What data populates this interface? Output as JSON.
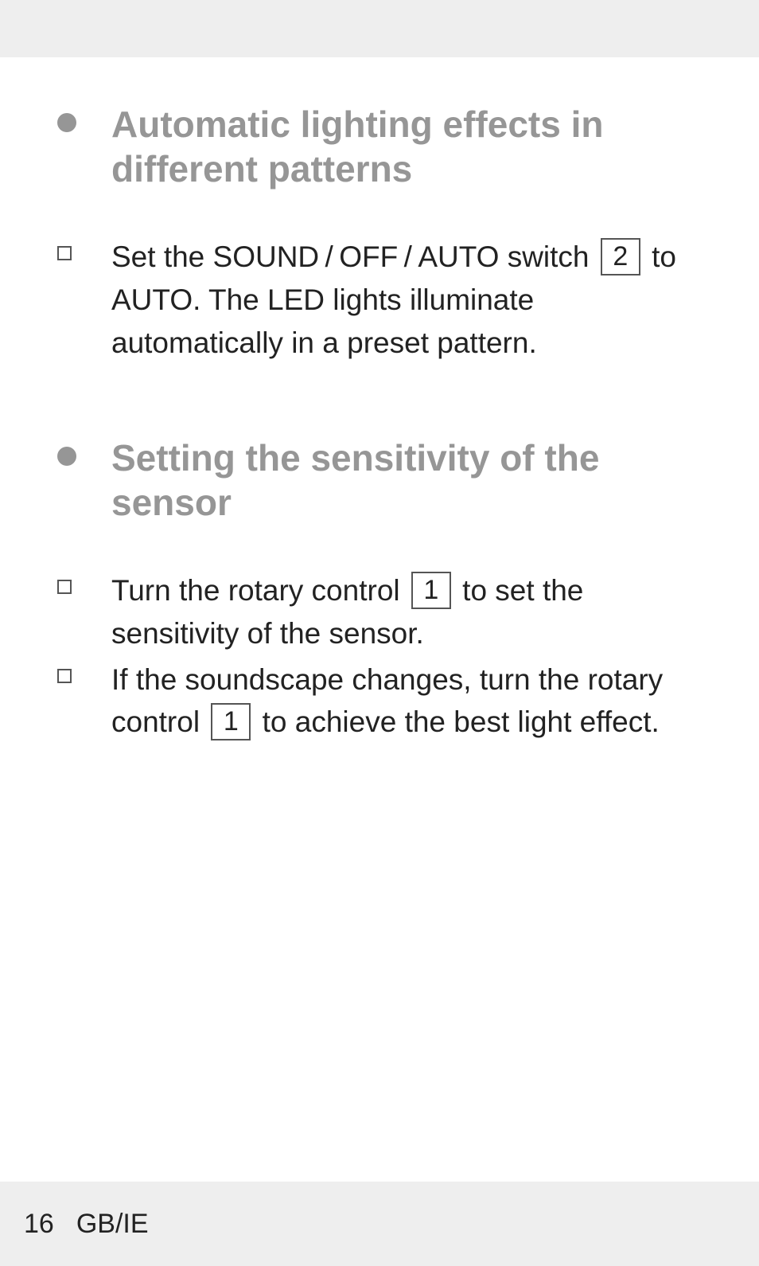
{
  "sections": [
    {
      "heading": "Automatic lighting effects in different patterns",
      "items": [
        {
          "pre": "Set the SOUND / OFF / AUTO switch ",
          "key": "2",
          "post": " to AUTO. The LED lights illuminate automatically in a preset pattern."
        }
      ]
    },
    {
      "heading": "Setting the sensitivity of the sensor",
      "items": [
        {
          "pre": "Turn the rotary control ",
          "key": "1",
          "post": " to set the sensitivity of the sensor."
        },
        {
          "pre": "If the soundscape changes, turn the rotary control ",
          "key": "1",
          "post": " to achieve the best light effect."
        }
      ]
    }
  ],
  "footer": {
    "page": "16",
    "locale": "GB/IE"
  }
}
